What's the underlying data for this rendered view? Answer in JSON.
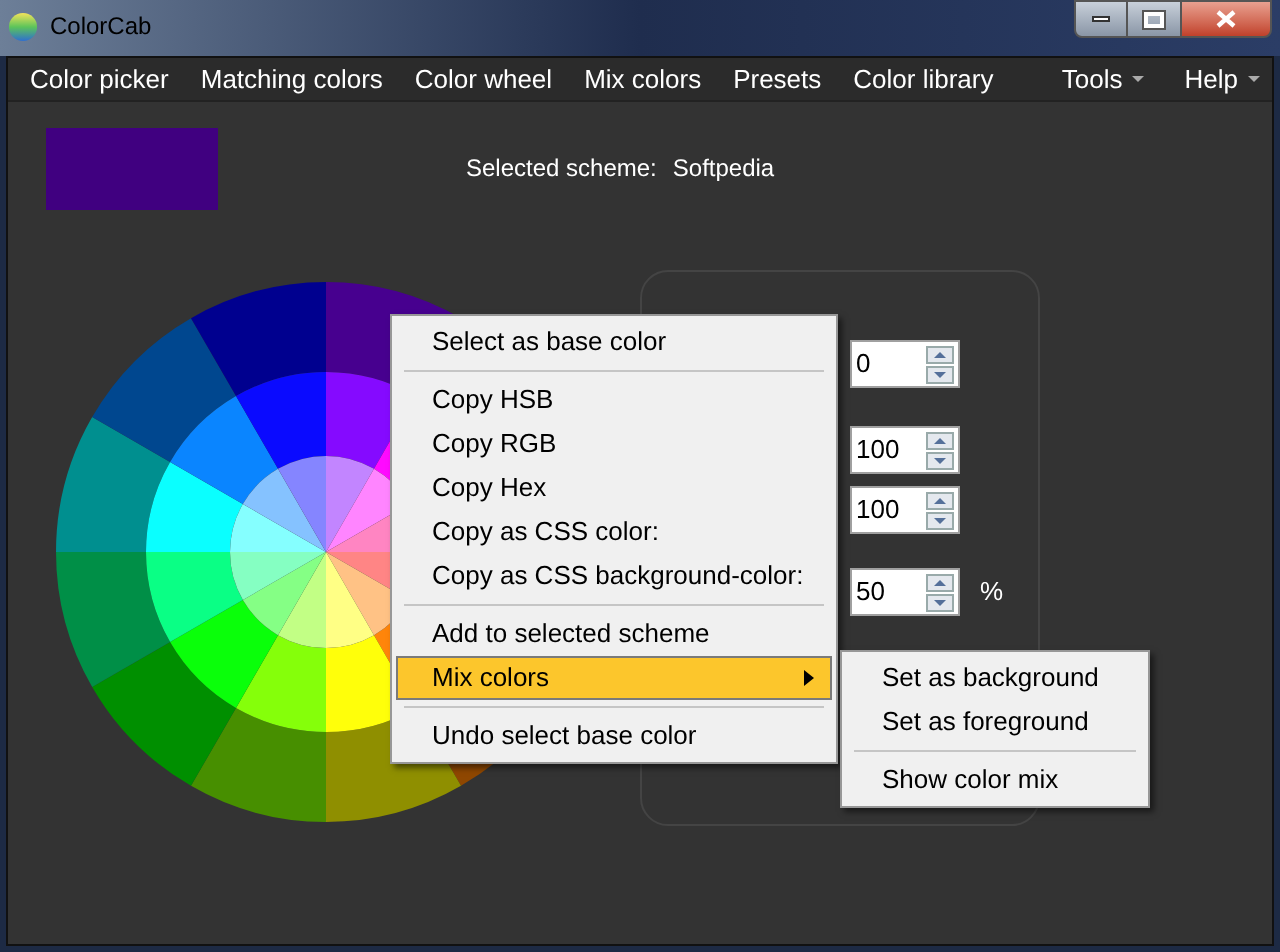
{
  "window": {
    "title": "ColorCab"
  },
  "menu_bar": [
    {
      "label": "Color picker",
      "kind": "plain"
    },
    {
      "label": "Matching colors",
      "kind": "plain"
    },
    {
      "label": "Color wheel",
      "kind": "plain"
    },
    {
      "label": "Mix colors",
      "kind": "plain"
    },
    {
      "label": "Presets",
      "kind": "plain"
    },
    {
      "label": "Color library",
      "kind": "plain"
    },
    {
      "label": "Tools",
      "kind": "dropdown"
    },
    {
      "label": "Help",
      "kind": "dropdown"
    }
  ],
  "base_color": {
    "color": "#400080"
  },
  "scheme": {
    "label": "Selected scheme:",
    "value": "Softpedia"
  },
  "spin_fields": [
    {
      "value": "0"
    },
    {
      "value": "100"
    },
    {
      "value": "100"
    },
    {
      "value": "50",
      "unit": "%"
    }
  ],
  "context_menu": [
    {
      "kind": "item",
      "label": "Select as base color",
      "selected": false
    },
    {
      "kind": "separator"
    },
    {
      "kind": "item",
      "label": "Copy HSB",
      "selected": false
    },
    {
      "kind": "item",
      "label": "Copy RGB",
      "selected": false
    },
    {
      "kind": "item",
      "label": "Copy Hex",
      "selected": false
    },
    {
      "kind": "item",
      "label": "Copy as CSS color:",
      "selected": false
    },
    {
      "kind": "item",
      "label": "Copy as CSS background-color:",
      "selected": false
    },
    {
      "kind": "separator"
    },
    {
      "kind": "item",
      "label": "Add to selected scheme",
      "selected": false
    },
    {
      "kind": "submenu",
      "label": "Mix colors",
      "selected": true
    },
    {
      "kind": "separator"
    },
    {
      "kind": "item",
      "label": "Undo select base color",
      "selected": false
    }
  ],
  "submenu": [
    {
      "kind": "item",
      "label": "Set as background",
      "selected": false
    },
    {
      "kind": "item",
      "label": "Set as foreground",
      "selected": false
    },
    {
      "kind": "separator"
    },
    {
      "kind": "item",
      "label": "Show color mix",
      "selected": false
    }
  ]
}
